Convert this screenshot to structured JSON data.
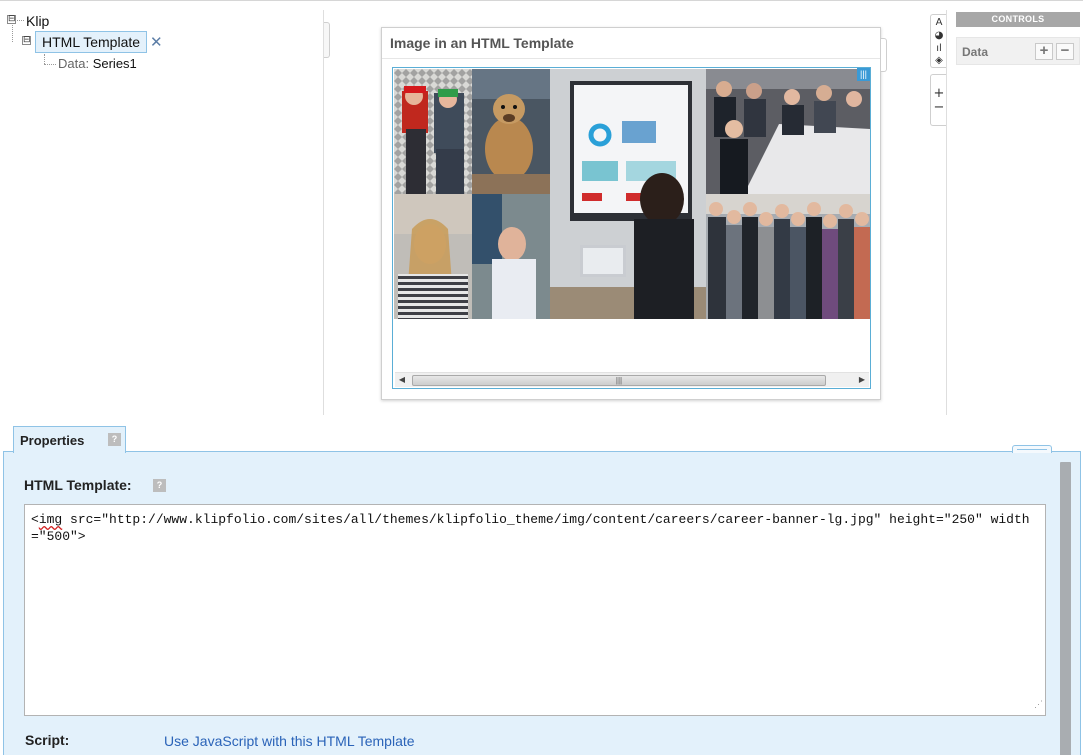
{
  "tree": {
    "root_label": "Klip",
    "component_label": "HTML Template",
    "data_label": "Data:",
    "data_value": "Series1",
    "expand_glyph": "⊟",
    "remove_glyph": "✕"
  },
  "preview": {
    "title": "Image in an HTML Template",
    "frame_corner_glyph": "|||",
    "scroll_left_glyph": "◀",
    "scroll_right_glyph": "▶",
    "scroll_thumb_glyph": "|||"
  },
  "toolbar": {
    "format_icons": [
      "A",
      "◕",
      "ıl",
      "◈"
    ],
    "zoom_in_label": "+",
    "zoom_out_label": "−"
  },
  "controls": {
    "header": "CONTROLS",
    "data_label": "Data",
    "add_label": "+",
    "remove_label": "−"
  },
  "properties": {
    "tab_label": "Properties",
    "help_label": "?",
    "html_template_label": "HTML Template:",
    "template_code_prefix": "<",
    "template_code_spell": "img",
    "template_code_rest": " src=\"http://www.klipfolio.com/sites/all/themes/klipfolio_theme/img/content/careers/career-banner-lg.jpg\" height=\"250\" width=\"500\">",
    "script_label": "Script:",
    "script_link": "Use JavaScript with this HTML Template"
  },
  "colors": {
    "accent_blue": "#3a9ad6",
    "panel_bg": "#e3f1fb",
    "panel_border": "#8fc3e6",
    "link": "#2a63b8"
  }
}
